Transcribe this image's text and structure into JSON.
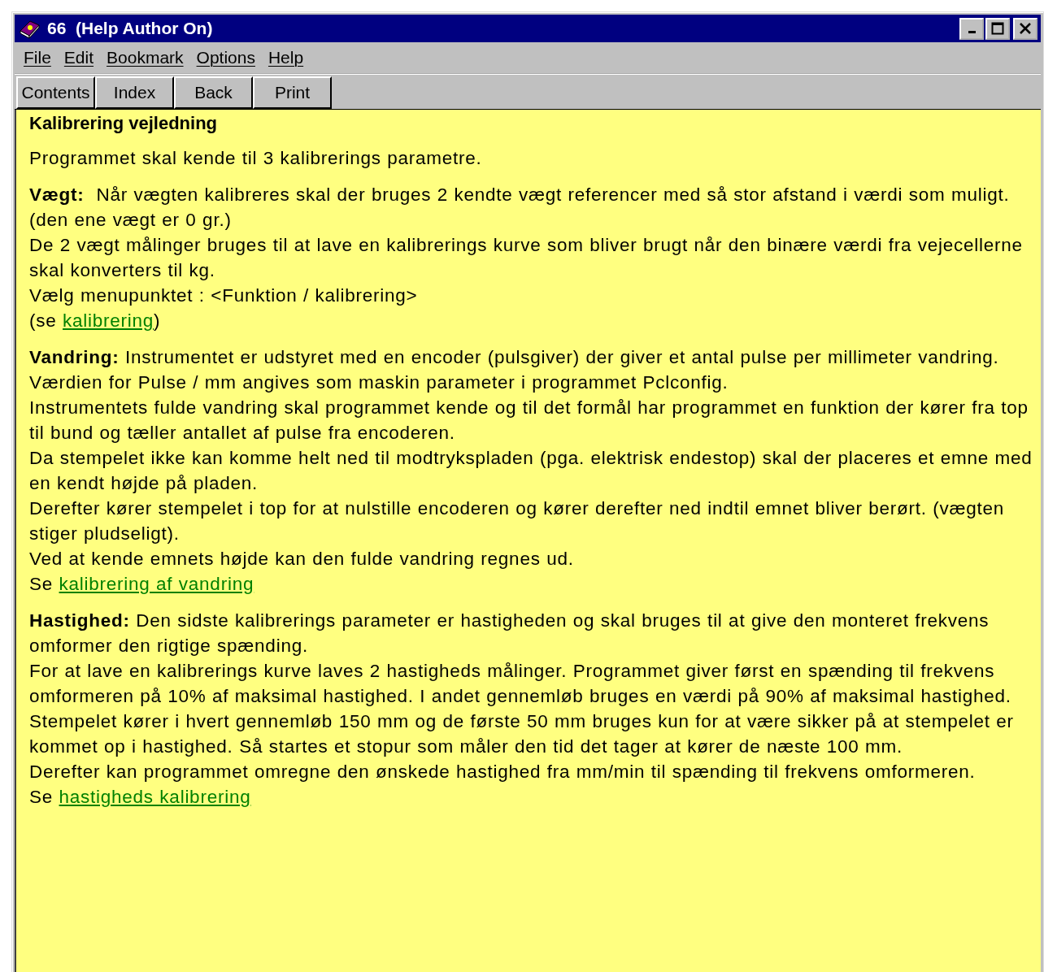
{
  "window": {
    "title": "66  (Help Author On)"
  },
  "menu": [
    "File",
    "Edit",
    "Bookmark",
    "Options",
    "Help"
  ],
  "buttons": [
    "Contents",
    "Index",
    "Back",
    "Print"
  ],
  "heading": "Kalibrering vejledning",
  "paragraphs": [
    {
      "lines": [
        [
          {
            "text": "Programmet skal kende til 3 kalibrerings parametre."
          }
        ]
      ]
    },
    {
      "lines": [
        [
          {
            "text": "**Vægt:**  Når vægten kalibreres skal der bruges 2 kendte vægt referencer med så stor afstand i værdi som muligt. (den ene vægt er 0 gr.)"
          }
        ],
        [
          {
            "text": "De 2 vægt målinger bruges til at lave en kalibrerings kurve som bliver brugt når den binære værdi fra vejecellerne skal konverters til kg."
          }
        ],
        [
          {
            "text": "Vælg menupunktet : <Funktion / kalibrering>"
          }
        ],
        [
          {
            "text": "(se "
          },
          {
            "link": "kalibrering"
          },
          {
            "text": ")"
          }
        ]
      ]
    },
    {
      "lines": [
        [
          {
            "text": "**Vandring:** Instrumentet er udstyret med en encoder (pulsgiver) der giver et antal pulse per millimeter vandring. Værdien for Pulse / mm angives som maskin parameter i programmet Pclconfig."
          }
        ],
        [
          {
            "text": "Instrumentets fulde vandring skal programmet kende og til det formål har programmet en funktion der kører fra top til bund og tæller antallet af pulse fra encoderen."
          }
        ],
        [
          {
            "text": "Da stempelet ikke kan komme helt ned til modtrykspladen (pga. elektrisk endestop) skal der placeres et emne med en kendt højde på pladen."
          }
        ],
        [
          {
            "text": "Derefter kører stempelet i top for at nulstille encoderen og kører derefter ned indtil emnet bliver berørt. (vægten stiger pludseligt)."
          }
        ],
        [
          {
            "text": "Ved at kende emnets højde kan den fulde vandring regnes ud."
          }
        ],
        [
          {
            "text": "Se "
          },
          {
            "link": "kalibrering af vandring"
          }
        ]
      ]
    },
    {
      "lines": [
        [
          {
            "text": "**Hastighed:** Den sidste kalibrerings parameter er hastigheden og skal bruges til at give den monteret frekvens omformer den rigtige spænding."
          }
        ],
        [
          {
            "text": "For at lave en kalibrerings kurve laves 2 hastigheds målinger. Programmet giver først en spænding til frekvens omformeren på 10% af maksimal hastighed. I andet gennemløb bruges en værdi på 90% af maksimal hastighed."
          }
        ],
        [
          {
            "text": "Stempelet kører i hvert gennemløb 150 mm og de første 50 mm bruges kun for at være sikker på at stempelet er kommet op i hastighed. Så startes et stopur som måler den tid det tager at kører de næste 100 mm."
          }
        ],
        [
          {
            "text": "Derefter kan programmet omregne den ønskede hastighed fra mm/min til spænding til frekvens omformeren."
          }
        ],
        [
          {
            "text": "Se "
          },
          {
            "link": "hastigheds kalibrering"
          }
        ]
      ]
    }
  ]
}
